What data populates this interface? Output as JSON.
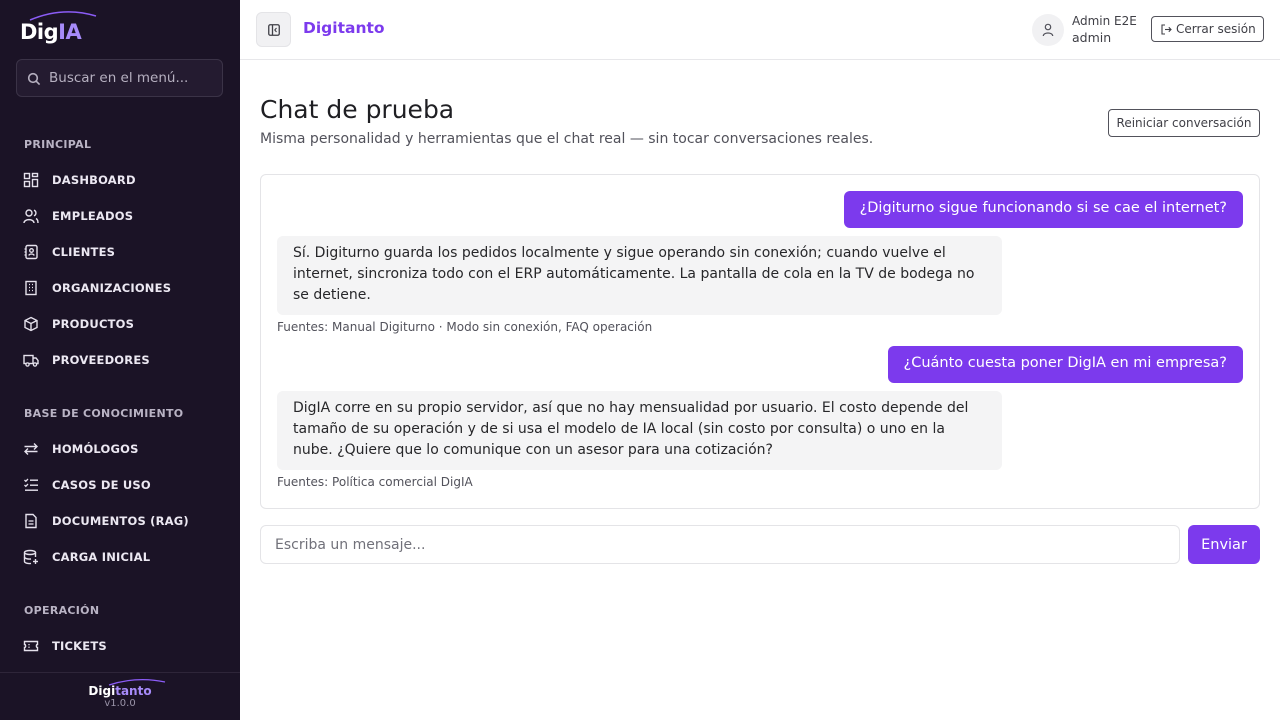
{
  "sidebar": {
    "logo": {
      "prefix": "Dig",
      "accent": "IA"
    },
    "search_placeholder": "Buscar en el menú...",
    "sections": [
      {
        "title": "PRINCIPAL",
        "items": [
          {
            "label": "DASHBOARD",
            "icon": "dashboard-icon"
          },
          {
            "label": "EMPLEADOS",
            "icon": "users-icon"
          },
          {
            "label": "CLIENTES",
            "icon": "contact-book-icon"
          },
          {
            "label": "ORGANIZACIONES",
            "icon": "building-icon"
          },
          {
            "label": "PRODUCTOS",
            "icon": "box-icon"
          },
          {
            "label": "PROVEEDORES",
            "icon": "truck-icon"
          }
        ]
      },
      {
        "title": "BASE DE CONOCIMIENTO",
        "items": [
          {
            "label": "HOMÓLOGOS",
            "icon": "swap-arrows-icon"
          },
          {
            "label": "CASOS DE USO",
            "icon": "list-checks-icon"
          },
          {
            "label": "DOCUMENTOS (RAG)",
            "icon": "document-icon"
          },
          {
            "label": "CARGA INICIAL",
            "icon": "database-plus-icon"
          }
        ]
      },
      {
        "title": "OPERACIÓN",
        "items": [
          {
            "label": "TICKETS",
            "icon": "ticket-icon"
          }
        ]
      }
    ],
    "footer": {
      "logo_prefix": "Digi",
      "logo_accent": "tanto",
      "version": "v1.0.0"
    }
  },
  "header": {
    "brand": "Digitanto",
    "user_name": "Admin E2E",
    "user_role": "admin",
    "logout_label": "Cerrar sesión"
  },
  "main": {
    "title": "Chat de prueba",
    "subtitle": "Misma personalidad y herramientas que el chat real — sin tocar conversaciones reales.",
    "reset_label": "Reiniciar conversación",
    "messages": [
      {
        "role": "user",
        "text": "¿Digiturno sigue funcionando si se cae el internet?"
      },
      {
        "role": "bot",
        "text": "Sí. Digiturno guarda los pedidos localmente y sigue operando sin conexión; cuando vuelve el internet, sincroniza todo con el ERP automáticamente. La pantalla de cola en la TV de bodega no se detiene.",
        "sources": "Fuentes: Manual Digiturno · Modo sin conexión, FAQ operación"
      },
      {
        "role": "user",
        "text": "¿Cuánto cuesta poner DigIA en mi empresa?"
      },
      {
        "role": "bot",
        "text": "DigIA corre en su propio servidor, así que no hay mensualidad por usuario. El costo depende del tamaño de su operación y de si usa el modelo de IA local (sin costo por consulta) o uno en la nube. ¿Quiere que lo comunique con un asesor para una cotización?",
        "sources": "Fuentes: Política comercial DigIA"
      }
    ],
    "input_placeholder": "Escriba un mensaje...",
    "send_label": "Enviar"
  },
  "colors": {
    "accent": "#7c3aed",
    "sidebar_bg": "#1b1326",
    "bot_bubble": "#f4f4f5"
  }
}
